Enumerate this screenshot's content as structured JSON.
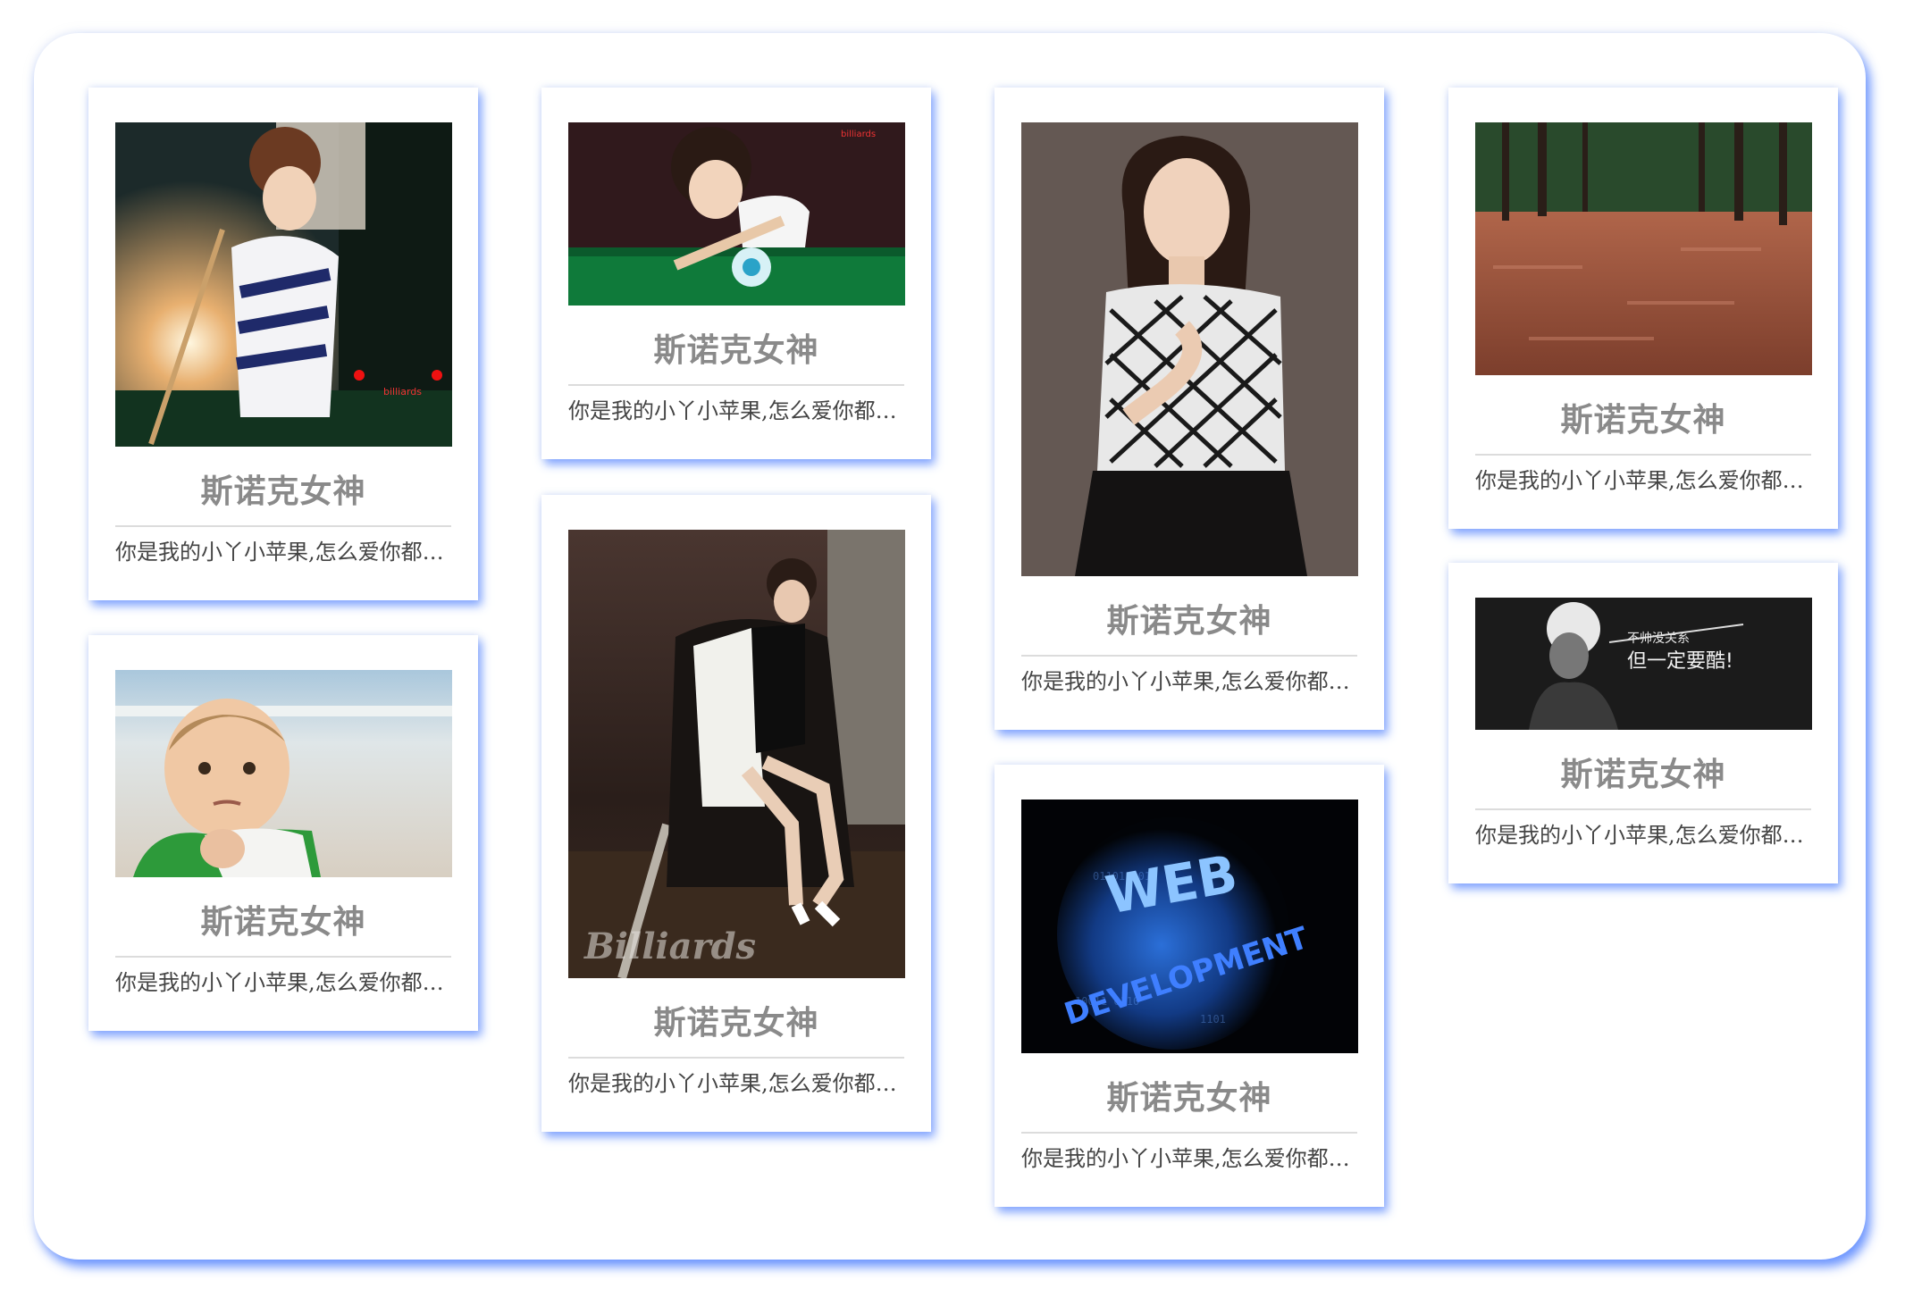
{
  "cards": [
    {
      "title": "斯诺克女神",
      "desc": "你是我的小丫小苹果,怎么爱你都不嫌多",
      "image": "billiards-girl-cue"
    },
    {
      "title": "斯诺克女神",
      "desc": "你是我的小丫小苹果,怎么爱你都不嫌多",
      "image": "success-kid-beach"
    },
    {
      "title": "斯诺克女神",
      "desc": "你是我的小丫小苹果,怎么爱你都不嫌多",
      "image": "billiards-girl-table"
    },
    {
      "title": "斯诺克女神",
      "desc": "你是我的小丫小苹果,怎么爱你都不嫌多",
      "image": "girl-armchair",
      "watermark": "Billiards"
    },
    {
      "title": "斯诺克女神",
      "desc": "你是我的小丫小苹果,怎么爱你都不嫌多",
      "image": "girl-portrait"
    },
    {
      "title": "斯诺克女神",
      "desc": "你是我的小丫小苹果,怎么爱你都不嫌多",
      "image": "web-development",
      "lines": [
        "WEB",
        "DEVELOPMENT"
      ]
    },
    {
      "title": "斯诺克女神",
      "desc": "你是我的小丫小苹果,怎么爱你都不嫌多",
      "image": "forest-leaves"
    },
    {
      "title": "斯诺克女神",
      "desc": "你是我的小丫小苹果,怎么爱你都不嫌多",
      "image": "chalkboard-quote",
      "lines": [
        "不帅没关系",
        "但一定要酷!"
      ]
    }
  ]
}
